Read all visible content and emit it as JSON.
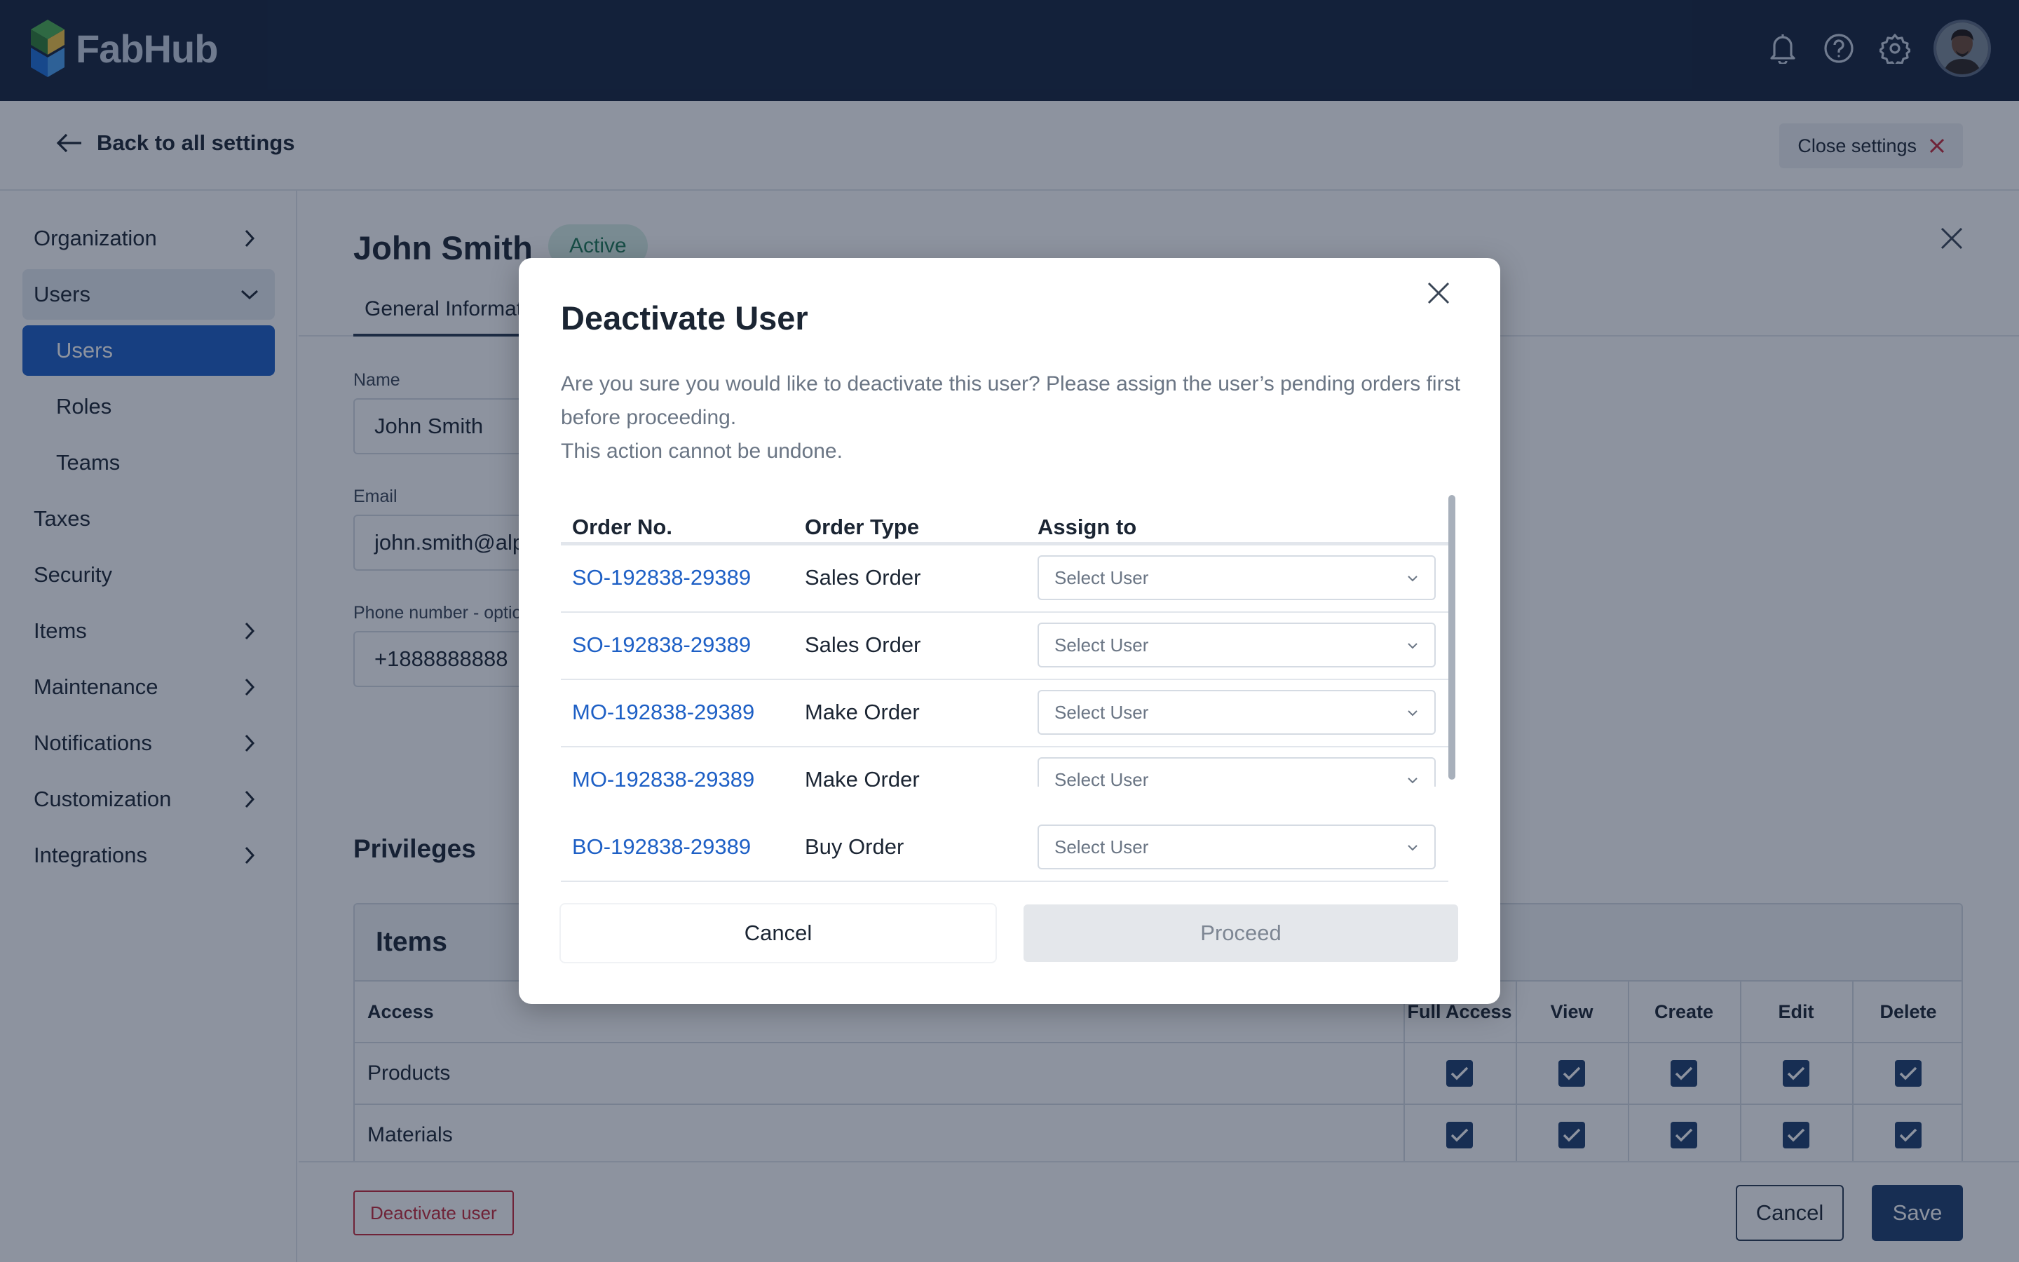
{
  "app": {
    "name": "FabHub",
    "icons": [
      "bell-icon",
      "help-icon",
      "gear-icon"
    ]
  },
  "subheader": {
    "back_label": "Back to all settings",
    "close_label": "Close settings"
  },
  "sidebar": {
    "items": [
      {
        "label": "Organization"
      },
      {
        "label": "Users"
      },
      {
        "label": "Users"
      },
      {
        "label": "Roles"
      },
      {
        "label": "Teams"
      },
      {
        "label": "Taxes"
      },
      {
        "label": "Security"
      },
      {
        "label": "Items"
      },
      {
        "label": "Maintenance"
      },
      {
        "label": "Notifications"
      },
      {
        "label": "Customization"
      },
      {
        "label": "Integrations"
      }
    ]
  },
  "user": {
    "name": "John Smith",
    "status": "Active",
    "tab_general": "General Information",
    "fields": {
      "name_label": "Name",
      "name_value": "John Smith",
      "email_label": "Email",
      "email_value": "john.smith@alphafabs.com",
      "phone_label": "Phone number - optional",
      "phone_value": "+1888888888"
    }
  },
  "privileges": {
    "title": "Privileges",
    "card_title": "Items",
    "access_header": "Access",
    "columns": [
      "Full Access",
      "View",
      "Create",
      "Edit",
      "Delete"
    ],
    "rows": [
      {
        "label": "Products"
      },
      {
        "label": "Materials"
      }
    ]
  },
  "footer": {
    "deactivate_label": "Deactivate user",
    "cancel_label": "Cancel",
    "save_label": "Save"
  },
  "modal": {
    "title": "Deactivate User",
    "desc_line1": "Are you sure you would like to deactivate this user? Please assign the user’s pending orders first before proceeding.",
    "desc_line2": "This action cannot be undone.",
    "headers": {
      "order_no": "Order No.",
      "order_type": "Order Type",
      "assign_to": "Assign to"
    },
    "rows": [
      {
        "order_no": "SO-192838-29389",
        "order_type": "Sales Order",
        "assign_placeholder": "Select User"
      },
      {
        "order_no": "SO-192838-29389",
        "order_type": "Sales Order",
        "assign_placeholder": "Select User"
      },
      {
        "order_no": "MO-192838-29389",
        "order_type": "Make Order",
        "assign_placeholder": "Select User"
      },
      {
        "order_no": "MO-192838-29389",
        "order_type": "Make Order",
        "assign_placeholder": "Select User"
      },
      {
        "order_no": "BO-192838-29389",
        "order_type": "Buy Order",
        "assign_placeholder": "Select User"
      }
    ],
    "cancel_label": "Cancel",
    "proceed_label": "Proceed"
  },
  "colors": {
    "header_bg": "#16243d",
    "accent": "#1d5fc5",
    "primary_btn": "#1d3f6e",
    "danger": "#c62a3a",
    "success_badge": "#d8f0e6"
  }
}
